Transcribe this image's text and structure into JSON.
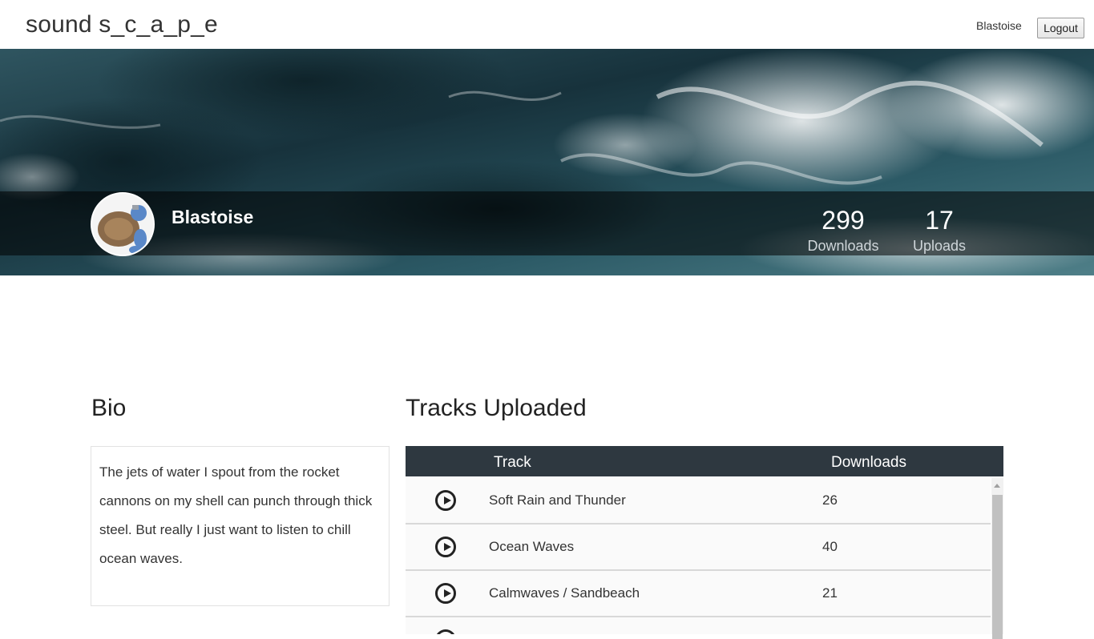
{
  "app": {
    "brand": "sound s_c_a_p_e"
  },
  "nav": {
    "username": "Blastoise",
    "logout_label": "Logout"
  },
  "profile": {
    "name": "Blastoise",
    "stats": {
      "downloads_count": "299",
      "downloads_label": "Downloads",
      "uploads_count": "17",
      "uploads_label": "Uploads"
    }
  },
  "bio": {
    "title": "Bio",
    "text": "The jets of water I spout from the rocket cannons on my shell can punch through thick steel. But really I just want to listen to chill ocean waves."
  },
  "tracks": {
    "title": "Tracks Uploaded",
    "columns": [
      "Track",
      "Downloads"
    ],
    "rows": [
      {
        "name": "Soft Rain and Thunder",
        "downloads": "26"
      },
      {
        "name": "Ocean Waves",
        "downloads": "40"
      },
      {
        "name": "Calmwaves / Sandbeach",
        "downloads": "21"
      },
      {
        "name": "",
        "downloads": ""
      }
    ]
  },
  "colors": {
    "table_header": "#2e3840",
    "hero_overlay": "rgba(0,0,0,0.55)",
    "ocean_dark": "#13303a",
    "ocean_light": "#5f8e98"
  }
}
